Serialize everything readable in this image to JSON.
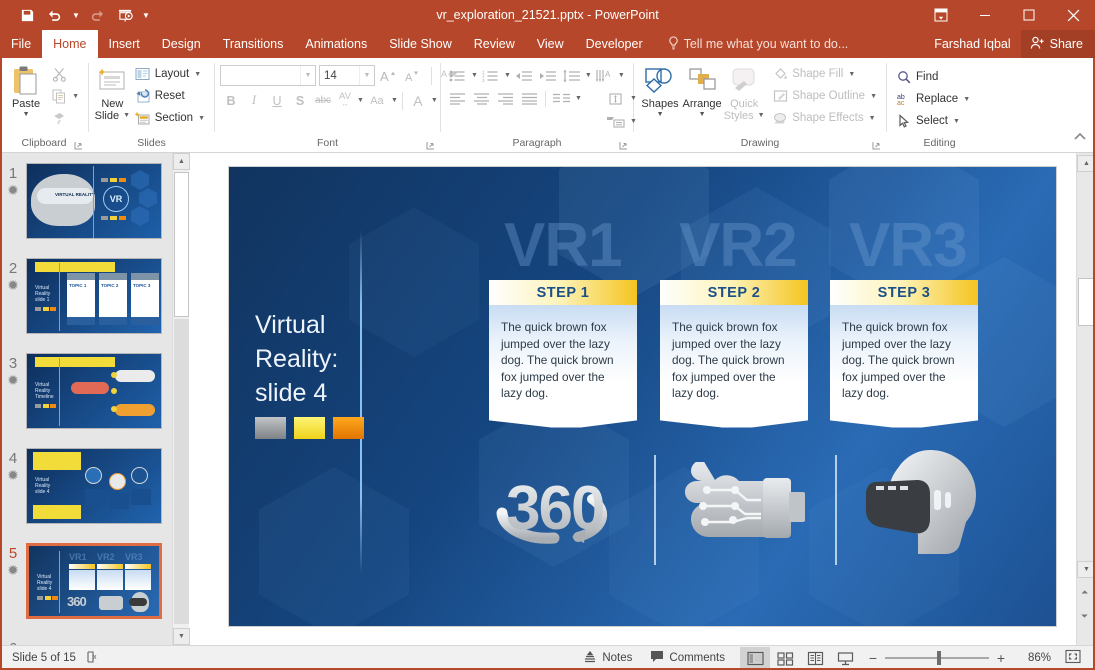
{
  "window": {
    "title": "vr_exploration_21521.pptx - PowerPoint",
    "restore_icon": "ribbon-display-options-icon",
    "minimize_icon": "minimize-icon",
    "maximize_icon": "maximize-icon",
    "close_icon": "close-icon"
  },
  "quick_access": {
    "items": [
      {
        "name": "save-icon",
        "label": "Save"
      },
      {
        "name": "undo-icon",
        "label": "Undo"
      },
      {
        "name": "redo-icon",
        "label": "Redo"
      },
      {
        "name": "start-presentation-icon",
        "label": "Start From Beginning"
      },
      {
        "name": "customize-quick-access-icon",
        "label": "Customize Quick Access Toolbar"
      }
    ]
  },
  "tabs": [
    {
      "label": "File",
      "active": false
    },
    {
      "label": "Home",
      "active": true
    },
    {
      "label": "Insert",
      "active": false
    },
    {
      "label": "Design",
      "active": false
    },
    {
      "label": "Transitions",
      "active": false
    },
    {
      "label": "Animations",
      "active": false
    },
    {
      "label": "Slide Show",
      "active": false
    },
    {
      "label": "Review",
      "active": false
    },
    {
      "label": "View",
      "active": false
    },
    {
      "label": "Developer",
      "active": false
    }
  ],
  "tell_me": {
    "placeholder": "Tell me what you want to do...",
    "icon": "lightbulb-icon"
  },
  "account": {
    "name": "Farshad Iqbal",
    "share_label": "Share",
    "share_icon": "share-person-icon"
  },
  "ribbon": {
    "clipboard": {
      "label": "Clipboard",
      "paste": "Paste",
      "cut": "Cut",
      "copy": "Copy",
      "format_painter": "Format Painter"
    },
    "slides": {
      "label": "Slides",
      "new_slide_line1": "New",
      "new_slide_line2": "Slide",
      "layout": "Layout",
      "reset": "Reset",
      "section": "Section"
    },
    "font": {
      "label": "Font",
      "font_name": "",
      "font_name_placeholder": "",
      "font_size": "14",
      "grow": "A",
      "shrink": "A",
      "clear_formatting": "Clear All Formatting",
      "bold": "B",
      "italic": "I",
      "underline": "U",
      "shadow": "S",
      "strikethrough": "abc",
      "char_spacing": "AV",
      "change_case": "Aa",
      "font_color": "A"
    },
    "paragraph": {
      "label": "Paragraph"
    },
    "drawing": {
      "label": "Drawing",
      "shapes": "Shapes",
      "arrange": "Arrange",
      "quick_styles_line1": "Quick",
      "quick_styles_line2": "Styles",
      "shape_fill": "Shape Fill",
      "shape_outline": "Shape Outline",
      "shape_effects": "Shape Effects"
    },
    "editing": {
      "label": "Editing",
      "find": "Find",
      "replace": "Replace",
      "select": "Select"
    },
    "collapse_icon": "collapse-ribbon-icon"
  },
  "thumbnails": [
    {
      "number": "1",
      "selected": false,
      "animated": true,
      "kind": "title"
    },
    {
      "number": "2",
      "selected": false,
      "animated": true,
      "kind": "topics3"
    },
    {
      "number": "3",
      "selected": false,
      "animated": true,
      "kind": "timeline"
    },
    {
      "number": "4",
      "selected": false,
      "animated": true,
      "kind": "process4"
    },
    {
      "number": "5",
      "selected": true,
      "animated": true,
      "kind": "vr3"
    }
  ],
  "slide": {
    "title": "Virtual Reality: slide 4",
    "swatches": [
      "#9a9a9a",
      "#f2e23a",
      "#f08a10"
    ],
    "ghost_labels": [
      "VR1",
      "VR2",
      "VR3"
    ],
    "steps": [
      {
        "banner": "STEP 1",
        "body": "The quick brown fox jumped over the lazy dog. The quick brown fox jumped over the lazy dog."
      },
      {
        "banner": "STEP 2",
        "body": "The quick brown fox jumped over the lazy dog. The quick brown fox jumped over the lazy dog."
      },
      {
        "banner": "STEP 3",
        "body": "The quick brown fox jumped over the lazy dog. The quick brown fox jumped over the lazy dog."
      }
    ],
    "artwork": [
      {
        "name": "360-degrees-icon",
        "label": "360"
      },
      {
        "name": "wired-glove-icon",
        "label": ""
      },
      {
        "name": "vr-headset-head-icon",
        "label": ""
      }
    ]
  },
  "status": {
    "slide_counter": "Slide 5 of 15",
    "spellcheck_icon": "spell-check-icon",
    "notes": "Notes",
    "notes_icon": "notes-icon",
    "comments": "Comments",
    "comments_icon": "comment-icon",
    "views": [
      {
        "name": "normal-view-button",
        "active": true
      },
      {
        "name": "slide-sorter-view-button",
        "active": false
      },
      {
        "name": "reading-view-button",
        "active": false
      },
      {
        "name": "slideshow-view-button",
        "active": false
      }
    ],
    "zoom_out": "−",
    "zoom_in": "+",
    "zoom_level": "86%",
    "fit_icon": "fit-slide-to-window-icon"
  },
  "theme": {
    "accent": "#b7472a",
    "tab_active_text": "#b7472a",
    "selection": "#e06c43"
  }
}
